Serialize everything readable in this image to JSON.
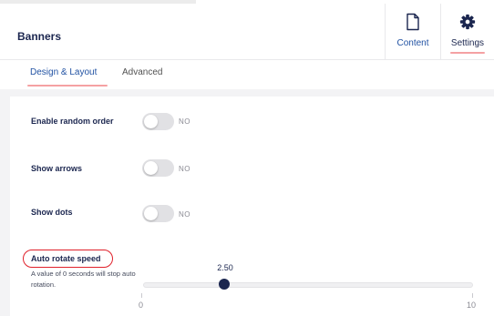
{
  "header": {
    "title": "Banners",
    "apps": [
      {
        "label": "Content",
        "icon": "document-icon"
      },
      {
        "label": "Settings",
        "icon": "gear-icon"
      }
    ]
  },
  "tabs": [
    {
      "label": "Design & Layout",
      "active": true
    },
    {
      "label": "Advanced",
      "active": false
    }
  ],
  "properties": {
    "random_order": {
      "label": "Enable random order",
      "state": "NO"
    },
    "show_arrows": {
      "label": "Show arrows",
      "state": "NO"
    },
    "show_dots": {
      "label": "Show dots",
      "state": "NO"
    },
    "auto_rotate": {
      "label": "Auto rotate speed",
      "description": "A value of 0 seconds will stop auto rotation.",
      "value": "2.50",
      "min": "0",
      "max": "10"
    }
  },
  "colors": {
    "accent": "#f5a1a3",
    "primary_text": "#1b264f",
    "link": "#2152a3",
    "highlight": "#e0202a",
    "toggle_off": "#e1e1e4"
  }
}
